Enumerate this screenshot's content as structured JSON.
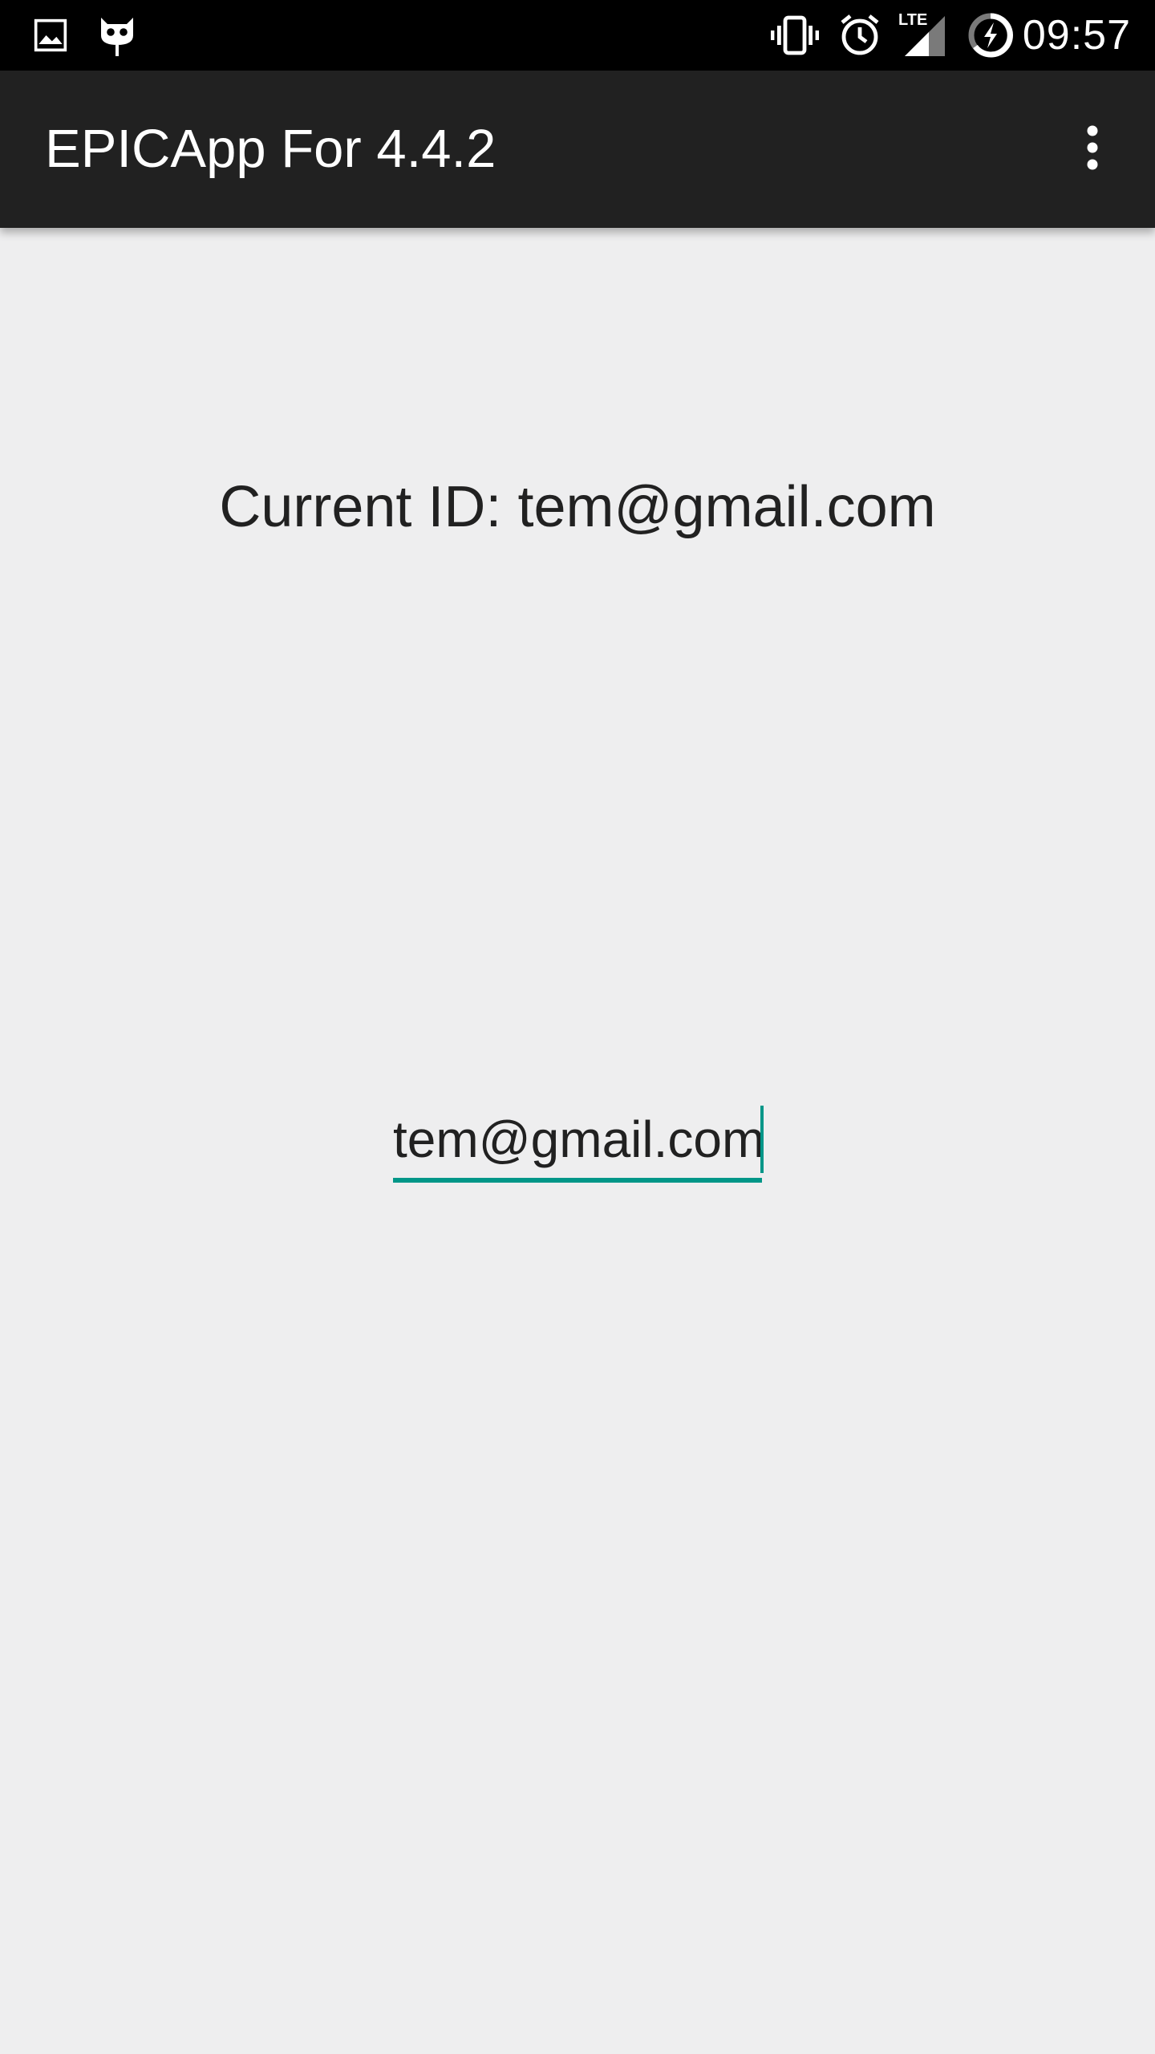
{
  "status_bar": {
    "time": "09:57",
    "network_label": "LTE",
    "icons": [
      "image-icon",
      "android-cat-icon",
      "vibrate-icon",
      "alarm-icon",
      "signal-icon",
      "battery-charging-icon"
    ]
  },
  "app_bar": {
    "title": "EPICApp For 4.4.2",
    "menu_icon": "more-vert-icon"
  },
  "main": {
    "current_id_label": "Current ID: tem@gmail.com",
    "id_input_value": "tem@gmail.com"
  },
  "colors": {
    "status_bar_bg": "#000000",
    "app_bar_bg": "#212121",
    "background": "#eeeeef",
    "accent": "#009688",
    "text": "#212121"
  }
}
